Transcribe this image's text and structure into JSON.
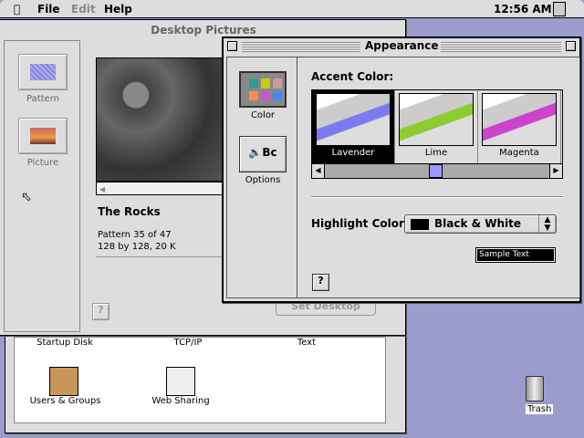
{
  "menubar": {
    "file": "File",
    "edit": "Edit",
    "help": "Help",
    "clock": "12:56 AM"
  },
  "finder": {
    "items": [
      "Startup Disk",
      "TCP/IP",
      "Text",
      "Users & Groups",
      "Web Sharing"
    ]
  },
  "desktop_pictures": {
    "title": "Desktop Pictures",
    "tabs": [
      "Pattern",
      "Picture"
    ],
    "name": "The Rocks",
    "info1": "Pattern 35 of 47",
    "info2": "128 by 128, 20 K",
    "set_button": "Set Desktop"
  },
  "appearance": {
    "title": "Appearance",
    "tabs": [
      "Color",
      "Options"
    ],
    "accent_label": "Accent Color:",
    "accents": [
      {
        "name": "Lavender",
        "color": "#7b7bef"
      },
      {
        "name": "Lime",
        "color": "#8ccc30"
      },
      {
        "name": "Magenta",
        "color": "#cc44cc"
      }
    ],
    "selected_accent": "Lavender",
    "highlight_label": "Highlight Color:",
    "highlight_value": "Black & White",
    "sample_text": "Sample Text"
  },
  "trash": {
    "label": "Trash"
  }
}
